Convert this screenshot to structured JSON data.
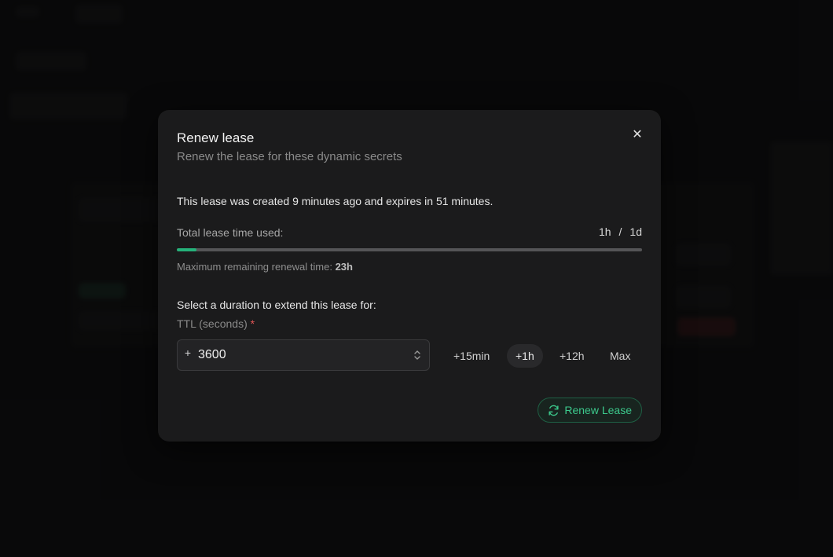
{
  "modal": {
    "title": "Renew lease",
    "subtitle": "Renew the lease for these dynamic secrets",
    "close_icon": "close-icon"
  },
  "lease": {
    "info_text": "This lease was created 9 minutes ago and expires in 51 minutes.",
    "usage_label": "Total lease time used:",
    "used": "1h",
    "separator": "/",
    "total": "1d",
    "progress_fraction": 0.042,
    "max_label": "Maximum remaining renewal time:",
    "max_value": "23h"
  },
  "extend": {
    "prompt": "Select a duration to extend this lease for:",
    "ttl_label": "TTL (seconds)",
    "required_marker": "*",
    "prefix": "+",
    "ttl_value": "3600",
    "presets": [
      "+15min",
      "+1h",
      "+12h",
      "Max"
    ],
    "active_preset": "+1h"
  },
  "actions": {
    "renew_label": "Renew Lease",
    "renew_icon": "refresh-icon"
  },
  "colors": {
    "accent": "#25b27a",
    "accent_text": "#3cc98c",
    "required": "#e05555"
  }
}
